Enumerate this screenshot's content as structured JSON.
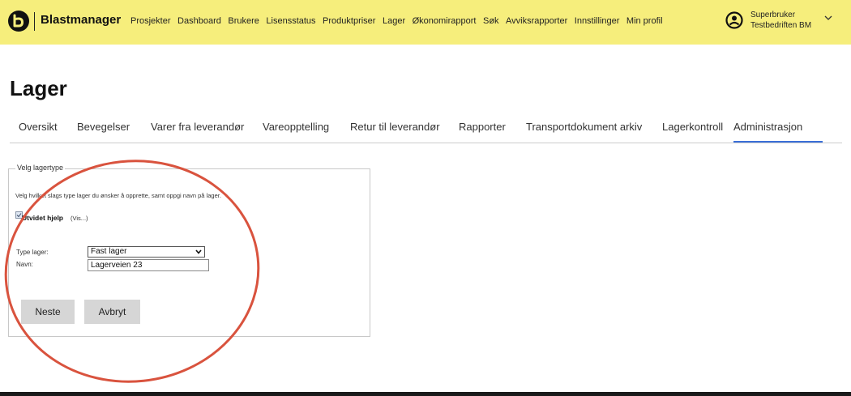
{
  "header": {
    "brand": "Blastmanager",
    "nav": [
      "Prosjekter",
      "Dashboard",
      "Brukere",
      "Lisensstatus",
      "Produktpriser",
      "Lager",
      "Økonomirapport",
      "Søk",
      "Avviksrapporter",
      "Innstillinger",
      "Min profil"
    ],
    "user_line1": "Superbruker",
    "user_line2": "Testbedriften BM"
  },
  "page": {
    "title": "Lager"
  },
  "tabs": [
    "Oversikt",
    "Bevegelser",
    "Varer fra leverandør",
    "Vareopptelling",
    "Retur til leverandør",
    "Rapporter",
    "Transportdokument arkiv",
    "Lagerkontroll",
    "Administrasjon"
  ],
  "active_tab": "Administrasjon",
  "form": {
    "legend": "Velg lagertype",
    "intro": "Velg hvilket slags type lager du ønsker å opprette, samt oppgi navn på lager.",
    "help_label": "Utvidet hjelp",
    "help_link": "(Vis...)",
    "type_label": "Type lager:",
    "type_value": "Fast lager",
    "name_label": "Navn:",
    "name_value": "Lagerveien 23",
    "next_label": "Neste",
    "cancel_label": "Avbryt"
  },
  "colors": {
    "header_bg": "#f6ee7c",
    "active_tab_underline": "#3a6fd8",
    "annotation_circle": "#d9533e"
  }
}
